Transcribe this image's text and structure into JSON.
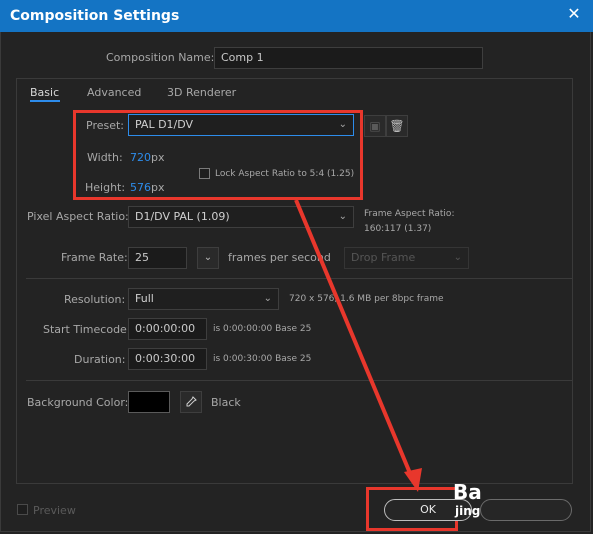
{
  "window": {
    "title": "Composition Settings",
    "close_glyph": "✕"
  },
  "composition_name": {
    "label": "Composition Name:",
    "value": "Comp 1"
  },
  "tabs": [
    {
      "label": "Basic"
    },
    {
      "label": "Advanced"
    },
    {
      "label": "3D Renderer"
    }
  ],
  "basic": {
    "preset": {
      "label": "Preset:",
      "value": "PAL D1/DV"
    },
    "width": {
      "label": "Width:",
      "value": "720",
      "unit": "px"
    },
    "height": {
      "label": "Height:",
      "value": "576",
      "unit": "px"
    },
    "lock_aspect": {
      "label": "Lock Aspect Ratio to 5:4 (1.25)"
    },
    "pixel_aspect": {
      "label": "Pixel Aspect Ratio:",
      "value": "D1/DV PAL (1.09)"
    },
    "frame_aspect": {
      "label": "Frame Aspect Ratio:",
      "value": "160:117 (1.37)"
    },
    "frame_rate": {
      "label": "Frame Rate:",
      "value": "25",
      "unit": "frames per second",
      "drop_frame": "Drop Frame"
    },
    "resolution": {
      "label": "Resolution:",
      "value": "Full",
      "info": "720 x 576, 1.6 MB per 8bpc frame"
    },
    "start_timecode": {
      "label": "Start Timecode:",
      "value": "0:00:00:00",
      "info": "is 0:00:00:00  Base 25"
    },
    "duration": {
      "label": "Duration:",
      "value": "0:00:30:00",
      "info": "is 0:00:30:00  Base 25"
    },
    "background": {
      "label": "Background Color:",
      "color_name": "Black",
      "swatch_color": "#000000"
    }
  },
  "footer": {
    "preview_label": "Preview",
    "ok_label": "OK"
  },
  "watermark": {
    "line1": "Ba",
    "line2": "jing"
  },
  "colors": {
    "titlebar": "#1474c4",
    "accent": "#2d8ceb",
    "annotation": "#e8372c"
  }
}
